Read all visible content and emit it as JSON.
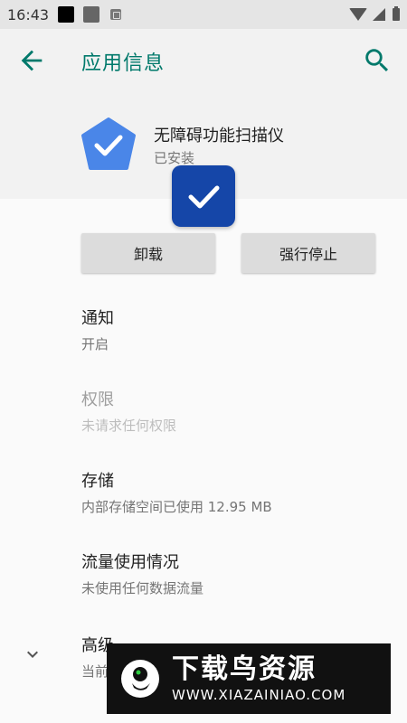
{
  "status_bar": {
    "time": "16:43"
  },
  "app_bar": {
    "title": "应用信息",
    "back_icon": "arrow-left-icon",
    "search_icon": "search-icon"
  },
  "app": {
    "name": "无障碍功能扫描仪",
    "status": "已安装",
    "icon": "pentagon-check-icon"
  },
  "buttons": {
    "uninstall": "卸载",
    "force_stop": "强行停止"
  },
  "settings": [
    {
      "title": "通知",
      "subtitle": "开启",
      "enabled": true
    },
    {
      "title": "权限",
      "subtitle": "未请求任何权限",
      "enabled": false
    },
    {
      "title": "存储",
      "subtitle": "内部存储空间已使用 12.95 MB",
      "enabled": true
    },
    {
      "title": "流量使用情况",
      "subtitle": "未使用任何数据流量",
      "enabled": true
    },
    {
      "title": "高级",
      "subtitle": "当前",
      "enabled": true
    }
  ],
  "watermark": {
    "title": "下载鸟资源",
    "url": "WWW.XIAZAINIAO.COM"
  },
  "colors": {
    "accent": "#00796b",
    "app_icon": "#4a86e8",
    "overlay": "#1546a8"
  }
}
